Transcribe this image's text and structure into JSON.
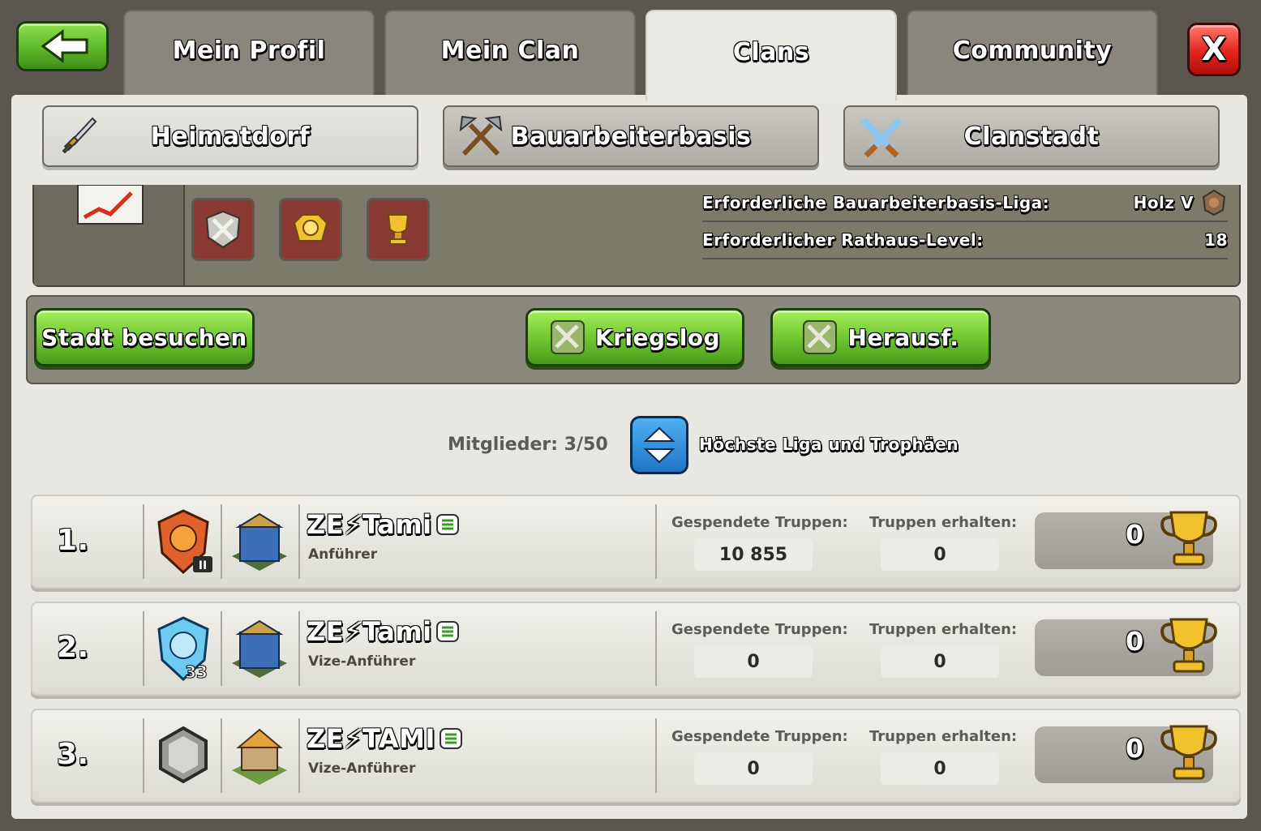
{
  "top_tabs": [
    {
      "label": "Mein Profil"
    },
    {
      "label": "Mein Clan"
    },
    {
      "label": "Clans"
    },
    {
      "label": "Community"
    }
  ],
  "close_label": "X",
  "sub_tabs": [
    {
      "label": "Heimatdorf"
    },
    {
      "label": "Bauarbeiterbasis"
    },
    {
      "label": "Clanstadt"
    }
  ],
  "requirements": {
    "builder_league_label": "Erforderliche Bauarbeiterbasis-Liga:",
    "builder_league_value": "Holz V",
    "townhall_label": "Erforderlicher Rathaus-Level:",
    "townhall_value": "18"
  },
  "actions": {
    "visit": "Stadt besuchen",
    "warlog": "Kriegslog",
    "challenge": "Herausf."
  },
  "members_label": "Mitglieder: 3/50",
  "sort_label": "Höchste Liga und Trophäen",
  "stat_labels": {
    "donated": "Gespendete Truppen:",
    "received": "Truppen erhalten:"
  },
  "members": [
    {
      "rank": "1.",
      "name": "ZE⚡Tami",
      "role": "Anführer",
      "donated": "10 855",
      "received": "0",
      "trophies": "0",
      "league_level": "II"
    },
    {
      "rank": "2.",
      "name": "ZE⚡Tami",
      "role": "Vize-Anführer",
      "donated": "0",
      "received": "0",
      "trophies": "0",
      "league_level": "33"
    },
    {
      "rank": "3.",
      "name": "ZE⚡TAMI",
      "role": "Vize-Anführer",
      "donated": "0",
      "received": "0",
      "trophies": "0",
      "league_level": ""
    }
  ]
}
